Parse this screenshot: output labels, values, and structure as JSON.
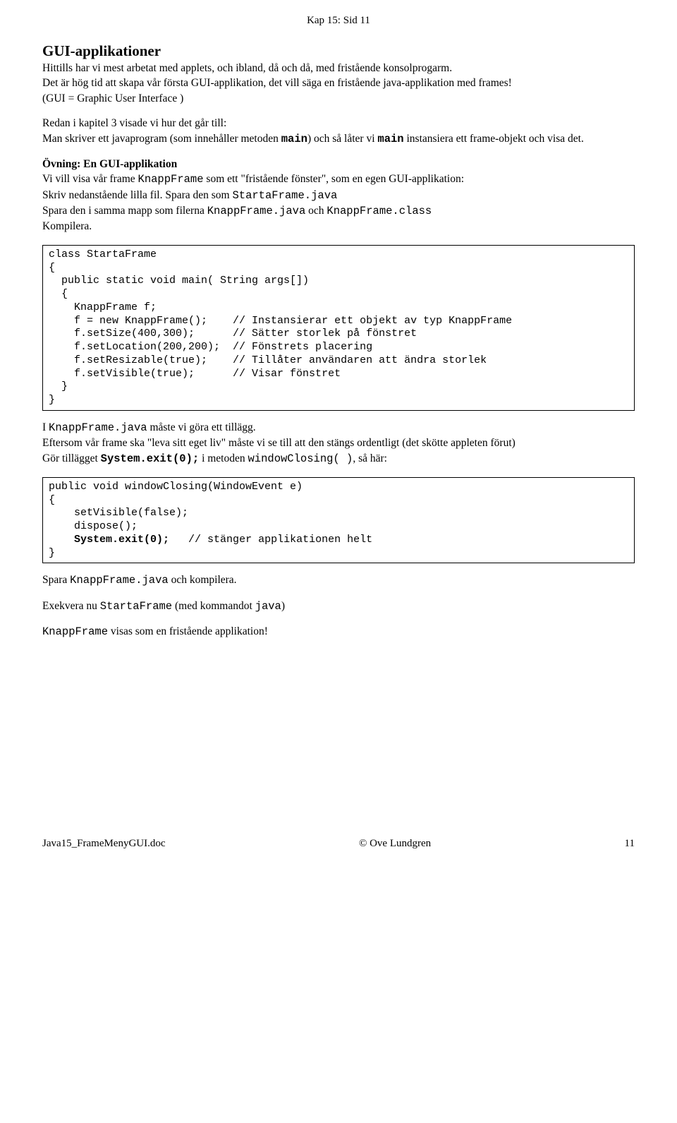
{
  "header": {
    "top": "Kap 15:  Sid 11"
  },
  "sec1": {
    "title": "GUI-applikationer",
    "p1": "Hittills har vi mest arbetat med applets, och ibland, då och då, med fristående konsolprogarm.",
    "p2": "Det är hög tid att skapa vår första GUI-applikation, det vill säga en fristående java-applikation med frames!",
    "p3": "(GUI = Graphic User Interface )"
  },
  "sec2": {
    "p1": "Redan i kapitel 3 visade vi hur det går till:",
    "p2a": "Man skriver ett javaprogram (som  innehåller metoden ",
    "p2b": "main",
    "p2c": ") och så låter vi ",
    "p2d": "main",
    "p2e": " instansiera ett frame-objekt och visa det."
  },
  "sec3": {
    "h": "Övning: En GUI-applikation",
    "p1a": "Vi vill visa vår frame ",
    "p1b": "KnappFrame",
    "p1c": " som ett \"fristående fönster\", som en egen GUI-applikation:",
    "p2a": "Skriv nedanstående lilla fil. Spara den som ",
    "p2b": "StartaFrame.java",
    "p3a": "Spara den i samma mapp som filerna ",
    "p3b": "KnappFrame.java",
    "p3c": " och ",
    "p3d": "KnappFrame.class",
    "p4": "Kompilera."
  },
  "code1": "class StartaFrame\n{\n  public static void main( String args[])\n  {\n    KnappFrame f;\n    f = new KnappFrame();    // Instansierar ett objekt av typ KnappFrame\n    f.setSize(400,300);      // Sätter storlek på fönstret\n    f.setLocation(200,200);  // Fönstrets placering\n    f.setResizable(true);    // Tillåter användaren att ändra storlek\n    f.setVisible(true);      // Visar fönstret\n  }\n}",
  "sec4": {
    "p1a": "I ",
    "p1b": "KnappFrame.java",
    "p1c": " måste vi göra ett tillägg.",
    "p2": "Eftersom vår frame ska \"leva sitt eget liv\" måste vi se till att den stängs ordentligt (det skötte appleten förut)",
    "p3a": "Gör tillägget  ",
    "p3b": "System.exit(0);",
    "p3c": "   i metoden ",
    "p3d": "windowClosing( )",
    "p3e": ",  så här:"
  },
  "code2a": "public void windowClosing(WindowEvent e)\n{\n    setVisible(false);\n    dispose();\n    ",
  "code2b": "System.exit(0);",
  "code2c": "   // stänger applikationen helt\n}",
  "sec5": {
    "p1a": "Spara ",
    "p1b": "KnappFrame.java",
    "p1c": " och kompilera.",
    "p2a": "Exekvera nu ",
    "p2b": "StartaFrame",
    "p2c": "  (med kommandot ",
    "p2d": "java",
    "p2e": ")",
    "p3a": "KnappFrame",
    "p3b": "  visas som en fristående applikation!"
  },
  "footer": {
    "left": "Java15_FrameMenyGUI.doc",
    "center": "© Ove Lundgren",
    "right": "11"
  }
}
